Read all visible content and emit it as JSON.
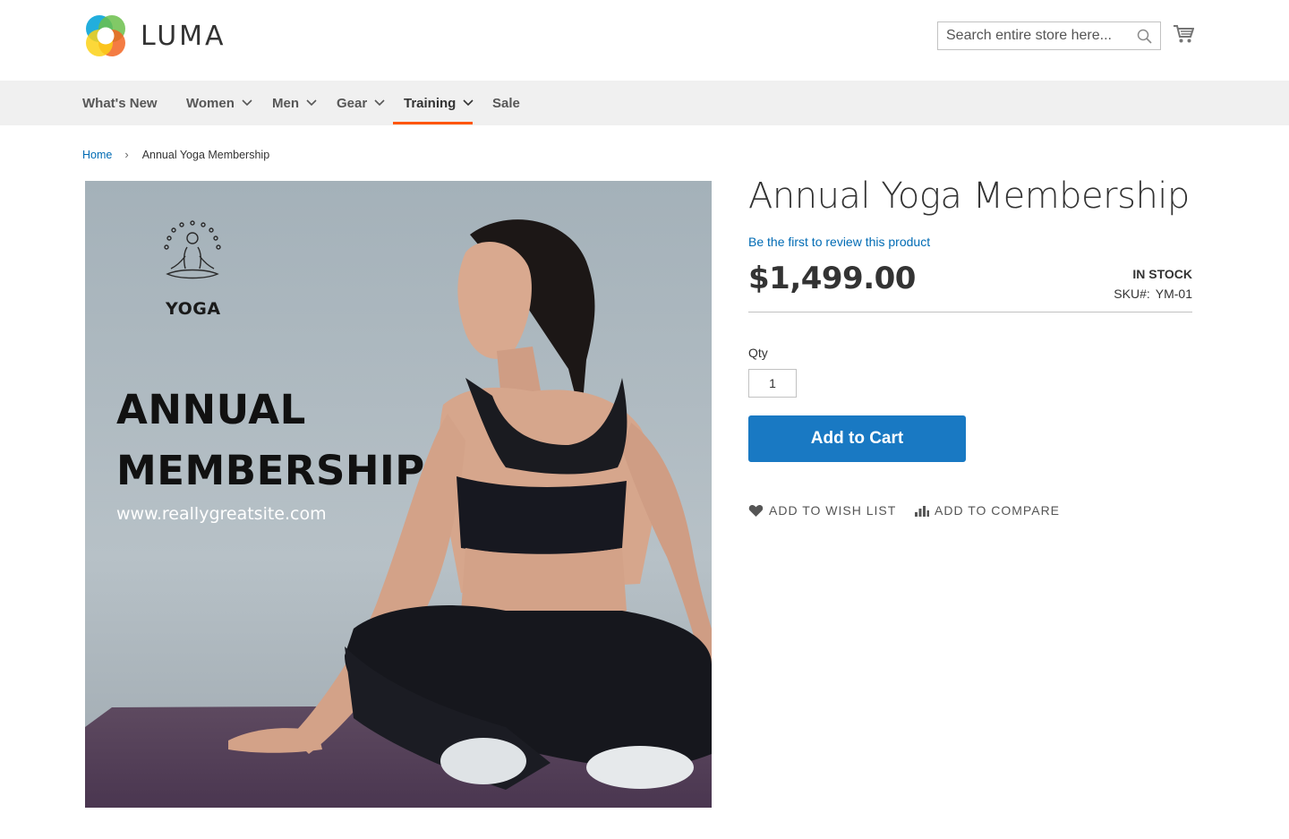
{
  "header": {
    "logo_text": "LUMA",
    "search": {
      "placeholder": "Search entire store here..."
    }
  },
  "icons": {
    "search": "search-icon",
    "cart": "cart-icon",
    "chevron": "chevron-down-icon",
    "heart": "heart-icon",
    "compare": "compare-icon"
  },
  "nav": {
    "items": [
      {
        "label": "What's New",
        "has_dropdown": false
      },
      {
        "label": "Women",
        "has_dropdown": true
      },
      {
        "label": "Men",
        "has_dropdown": true
      },
      {
        "label": "Gear",
        "has_dropdown": true
      },
      {
        "label": "Training",
        "has_dropdown": true,
        "active": true
      },
      {
        "label": "Sale",
        "has_dropdown": false
      }
    ]
  },
  "breadcrumb": {
    "home": "Home",
    "separator": "›",
    "current": "Annual Yoga Membership"
  },
  "product_image": {
    "brand": "YOGA",
    "headline_line1": "ANNUAL",
    "headline_line2": "MEMBERSHIP",
    "url": "www.reallygreatsite.com"
  },
  "product": {
    "title": "Annual Yoga Membership",
    "review_link": "Be the first to review this product",
    "price": "$1,499.00",
    "stock": "IN STOCK",
    "sku_label": "SKU#:",
    "sku_value": "YM-01",
    "qty_label": "Qty",
    "qty_value": "1",
    "add_to_cart": "Add to Cart",
    "wishlist": "ADD TO WISH LIST",
    "compare": "ADD TO COMPARE"
  },
  "colors": {
    "accent_blue": "#1979c3",
    "link_blue": "#006bb4",
    "nav_active": "#ff5501",
    "nav_bg": "#f0f0f0"
  }
}
